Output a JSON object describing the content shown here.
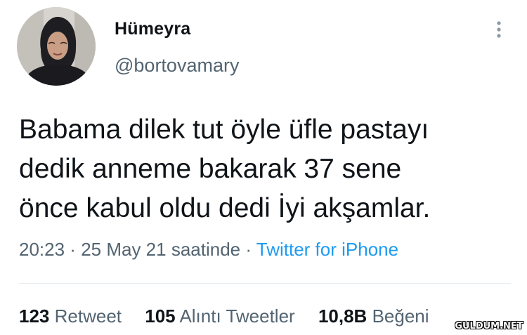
{
  "user": {
    "display_name": "Hümeyra",
    "handle": "@bortovamary"
  },
  "tweet": {
    "text": "Babama dilek tut öyle üfle pastayı\ndedik anneme bakarak 37 sene\nönce kabul oldu dedi İyi akşamlar."
  },
  "meta": {
    "time": "20:23",
    "sep1": " · ",
    "date": "25 May 21 saatinde",
    "sep2": " · ",
    "source": "Twitter for iPhone"
  },
  "stats": {
    "retweets_count": "123",
    "retweets_label": "Retweet",
    "quotes_count": "105",
    "quotes_label": "Alıntı Tweetler",
    "likes_count": "10,8B",
    "likes_label": "Beğeni"
  },
  "watermark": "GULDUM.NET",
  "icons": {
    "more": "more-vertical-icon",
    "avatar": "profile-photo"
  }
}
